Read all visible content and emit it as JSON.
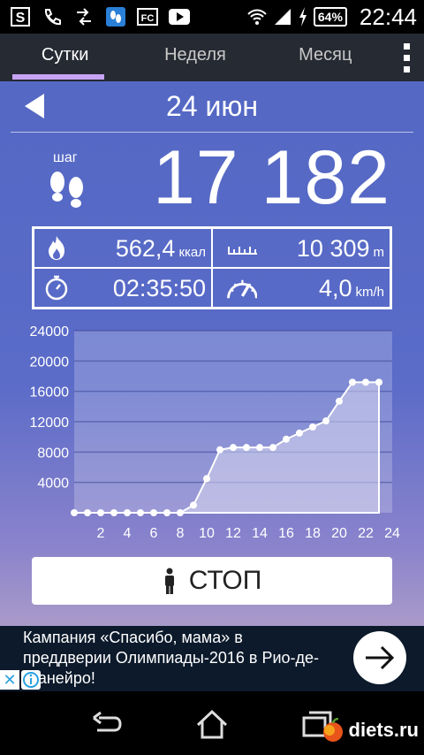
{
  "status_bar": {
    "battery": "64%",
    "time": "22:44",
    "icons": [
      "s-icon",
      "phone-icon",
      "data-icon",
      "steps-app-icon",
      "fc-icon",
      "youtube-icon",
      "wifi-icon",
      "signal-icon",
      "charging-icon"
    ]
  },
  "tabs": [
    {
      "label": "Сутки",
      "active": true
    },
    {
      "label": "Неделя",
      "active": false
    },
    {
      "label": "Месяц",
      "active": false
    }
  ],
  "date": "24 июн",
  "steps": {
    "label": "шаг",
    "value": "17 182"
  },
  "stats": {
    "calories": {
      "value": "562,4",
      "unit": "ккал"
    },
    "distance": {
      "value": "10 309",
      "unit": "m"
    },
    "time": {
      "value": "02:35:50"
    },
    "speed": {
      "value": "4,0",
      "unit": "km/h"
    }
  },
  "chart_data": {
    "type": "area",
    "x": [
      0,
      1,
      2,
      3,
      4,
      5,
      6,
      7,
      8,
      9,
      10,
      11,
      12,
      13,
      14,
      15,
      16,
      17,
      18,
      19,
      20,
      21,
      22,
      23
    ],
    "y": [
      0,
      0,
      0,
      0,
      0,
      0,
      0,
      0,
      0,
      1000,
      4500,
      8300,
      8600,
      8600,
      8600,
      8600,
      9700,
      10500,
      11300,
      12100,
      14700,
      17200,
      17200,
      17200
    ],
    "x_ticks": [
      "2",
      "4",
      "6",
      "8",
      "10",
      "12",
      "14",
      "16",
      "18",
      "20",
      "22",
      "24"
    ],
    "y_ticks": [
      "4000",
      "8000",
      "12000",
      "16000",
      "20000",
      "24000"
    ],
    "ylim": [
      0,
      24000
    ],
    "xlim": [
      0,
      24
    ],
    "grid": true
  },
  "stop_button": {
    "label": "СТОП"
  },
  "ad": {
    "text": "Кампания «Спасибо, мама» в преддверии Олимпиады-2016 в Рио-де-Жанейро!",
    "close": "✕"
  },
  "watermark": "diets.ru",
  "colors": {
    "tab_indicator": "#c7a3f5",
    "chart_fill": "#c9c9ea",
    "background_top": "#5468c4"
  }
}
